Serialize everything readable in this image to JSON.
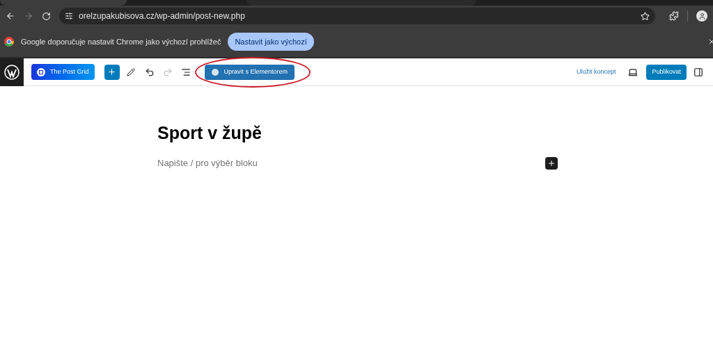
{
  "browser": {
    "url": "orelzupakubisova.cz/wp-admin/post-new.php",
    "forward_disabled": true
  },
  "infobar": {
    "message": "Google doporučuje nastavit Chrome jako výchozí prohlížeč",
    "button": "Nastavit jako výchozí"
  },
  "toolbar": {
    "post_grid": "The Post Grid",
    "redo_disabled": true,
    "elementor": "Upravit s Elementorem",
    "elementor_circled": true,
    "save_draft": "Uložit koncept",
    "publish": "Publikovat"
  },
  "editor": {
    "title": "Sport v župě",
    "placeholder": "Napište / pro výběr bloku"
  }
}
